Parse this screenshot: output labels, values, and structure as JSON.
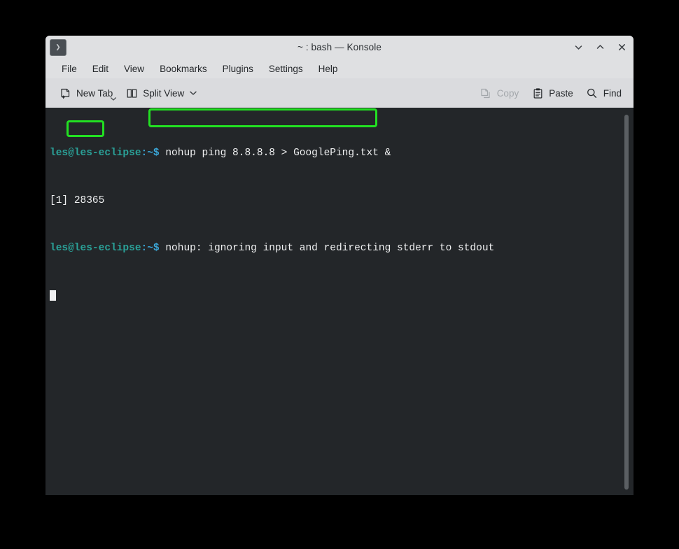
{
  "window": {
    "title": "~ : bash — Konsole",
    "app_icon": "konsole-prompt-icon",
    "buttons": {
      "minimize": "minimize",
      "maximize": "maximize",
      "close": "close"
    }
  },
  "menubar": {
    "items": [
      {
        "label": "File"
      },
      {
        "label": "Edit"
      },
      {
        "label": "View"
      },
      {
        "label": "Bookmarks"
      },
      {
        "label": "Plugins"
      },
      {
        "label": "Settings"
      },
      {
        "label": "Help"
      }
    ]
  },
  "toolbar": {
    "new_tab_label": "New Tab",
    "split_view_label": "Split View",
    "copy_label": "Copy",
    "paste_label": "Paste",
    "find_label": "Find",
    "copy_enabled": false
  },
  "terminal": {
    "background_color": "#232629",
    "foreground_color": "#eff0f1",
    "prompt_user_color": "#2aa198",
    "prompt_path_color": "#3ba7d8",
    "lines": [
      {
        "prompt_user": "les@les-eclipse",
        "prompt_path": ":~$",
        "command": " nohup ping 8.8.8.8 > GooglePing.txt &"
      },
      {
        "job": "[1] ",
        "pid": "28365"
      },
      {
        "prompt_user": "les@les-eclipse",
        "prompt_path": ":~$",
        "output": " nohup: ignoring input and redirecting stderr to stdout"
      }
    ],
    "cursor": "block"
  },
  "annotations": {
    "highlight_color": "#22e022",
    "boxes": [
      {
        "name": "command-highlight",
        "target": "nohup ping 8.8.8.8 > GooglePing.txt &"
      },
      {
        "name": "pid-highlight",
        "target": "28365"
      }
    ]
  }
}
